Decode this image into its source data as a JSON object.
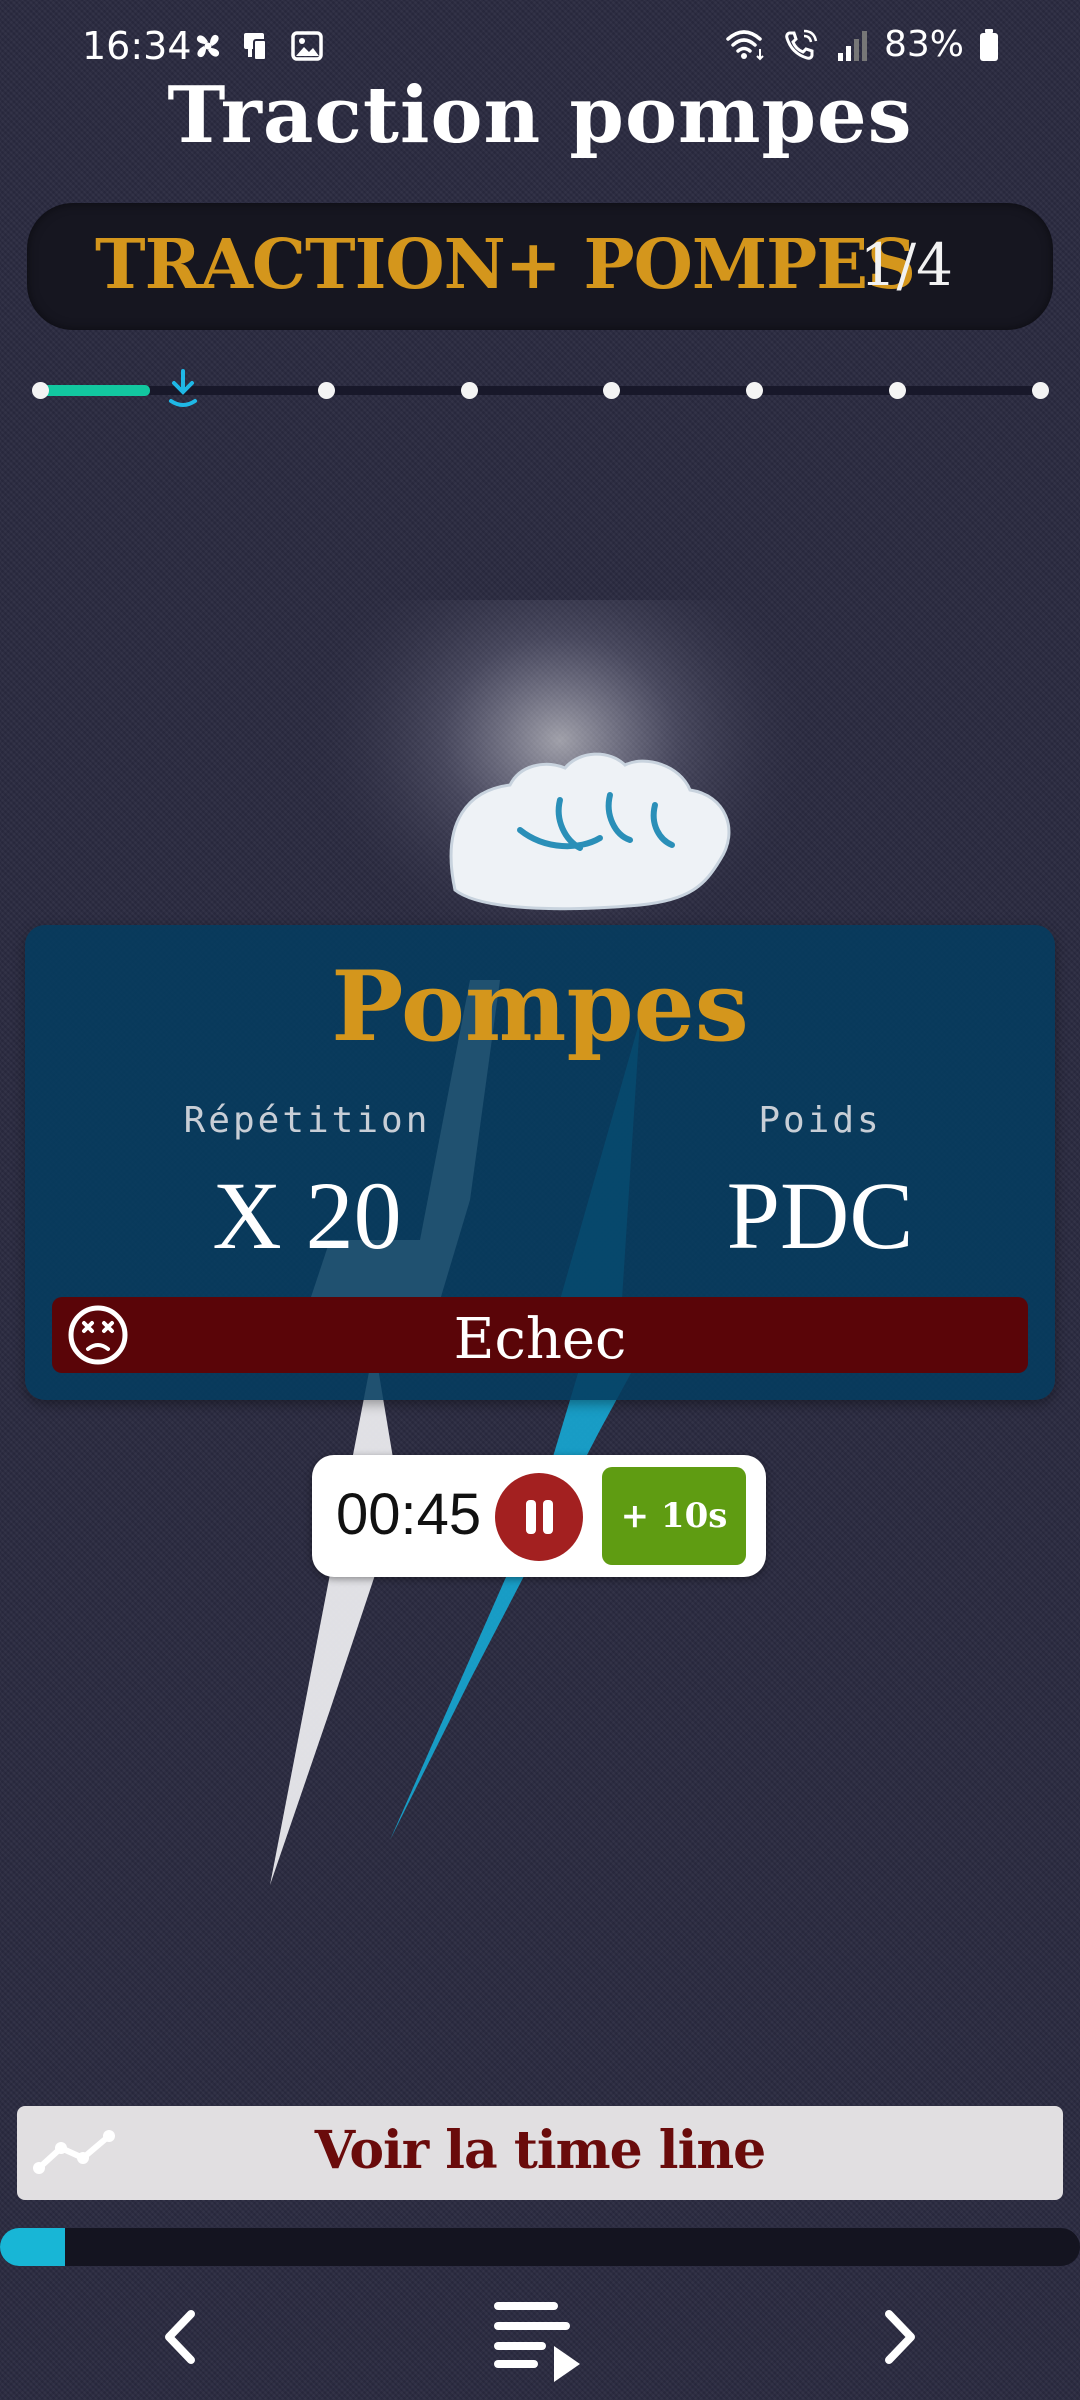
{
  "status_bar": {
    "time": "16:34",
    "battery": "83%",
    "left_icons": [
      "fan-icon",
      "phone-sync-icon",
      "gallery-icon"
    ],
    "right_icons": [
      "wifi-icon",
      "wifi-call-icon",
      "signal-icon",
      "battery-icon"
    ]
  },
  "page": {
    "title": "Traction pompes"
  },
  "workout": {
    "name": "TRACTION+ POMPES",
    "step": "1/4",
    "steps_total": 8,
    "current_step": 2,
    "completed_fraction": 0.11
  },
  "exercise": {
    "name": "Pompes",
    "reps_label": "Répétition",
    "reps_value": "X 20",
    "weight_label": "Poids",
    "weight_value": "PDC",
    "fail_label": "Echec"
  },
  "timer": {
    "value": "00:45",
    "add_label": "+ 10s"
  },
  "timeline": {
    "label": "Voir la time line"
  },
  "session_progress": 0.06,
  "colors": {
    "accent_gold": "#d4961c",
    "progress_teal": "#12c7a0",
    "progress_cyan": "#18b6d6",
    "fail_red": "#5a0508",
    "pause_red": "#a32020",
    "add_green": "#5f9c12",
    "card_blue": "#043c60",
    "timeline_text": "#6a0b0b"
  }
}
